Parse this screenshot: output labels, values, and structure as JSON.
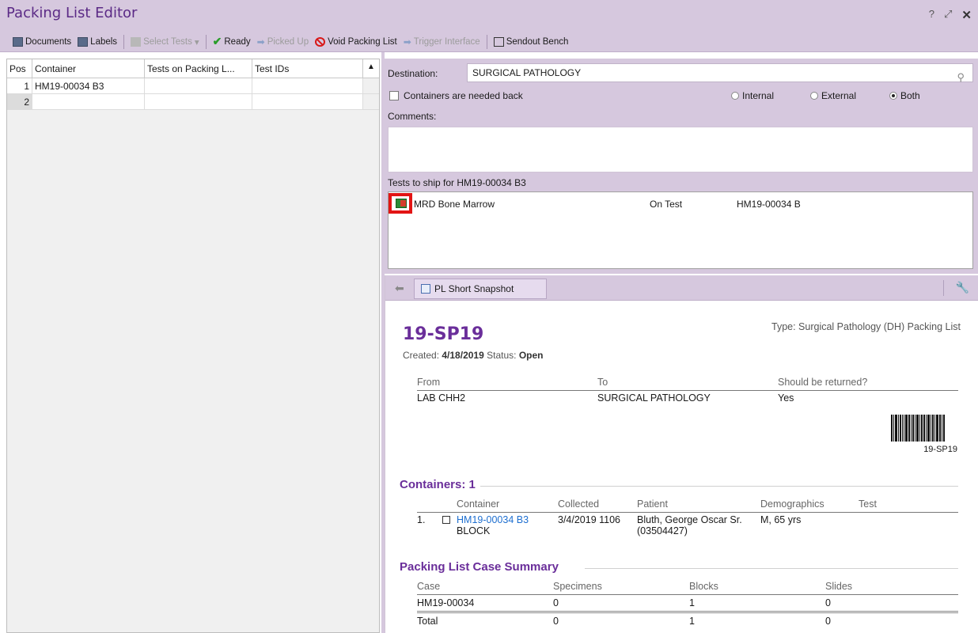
{
  "window": {
    "title": "Packing List Editor"
  },
  "toolbar": {
    "documents": "Documents",
    "labels": "Labels",
    "select_tests": "Select Tests",
    "ready": "Ready",
    "picked_up": "Picked Up",
    "void_packing_list": "Void Packing List",
    "trigger_interface": "Trigger Interface",
    "sendout_bench": "Sendout Bench"
  },
  "grid": {
    "headers": [
      "Pos",
      "Container",
      "Tests on Packing L...",
      "Test IDs"
    ],
    "rows": [
      {
        "pos": "1",
        "container": "HM19-00034 B3",
        "tests": "",
        "ids": ""
      },
      {
        "pos": "2",
        "container": "",
        "tests": "",
        "ids": ""
      }
    ]
  },
  "destination": {
    "label": "Destination:",
    "value": "SURGICAL PATHOLOGY"
  },
  "containers_needed_back": {
    "label": "Containers are needed back",
    "checked": false
  },
  "scope_radios": [
    {
      "label": "Internal",
      "selected": false
    },
    {
      "label": "External",
      "selected": false
    },
    {
      "label": "Both",
      "selected": true
    }
  ],
  "comments": {
    "label": "Comments:",
    "value": ""
  },
  "tests_to_ship": {
    "label": "Tests to ship for HM19-00034 B3",
    "items": [
      {
        "name": "MRD Bone Marrow",
        "status": "On Test",
        "id": "HM19-00034 B"
      }
    ]
  },
  "snapshot": {
    "tab_label": "PL Short Snapshot",
    "packing_list_id": "19-SP19",
    "type_text": "Type: Surgical Pathology (DH) Packing List",
    "created_label": "Created:",
    "created_date": "4/18/2019",
    "status_label": "Status:",
    "status_value": "Open",
    "from_to": {
      "headers": [
        "From",
        "To",
        "Should be returned?"
      ],
      "values": [
        "LAB CHH2",
        "SURGICAL PATHOLOGY",
        "Yes"
      ]
    },
    "barcode_text": "19-SP19",
    "containers_title": "Containers: 1",
    "containers_headers": [
      "Container",
      "Collected",
      "Patient",
      "Demographics",
      "Test"
    ],
    "containers": [
      {
        "num": "1.",
        "container": "HM19-00034 B3",
        "container_type": "BLOCK",
        "collected": "3/4/2019 1106",
        "patient": "Bluth, George Oscar Sr.",
        "patient_id": "(03504427)",
        "demographics": "M, 65 yrs",
        "test": ""
      }
    ],
    "summary_title": "Packing List Case Summary",
    "summary_headers": [
      "Case",
      "Specimens",
      "Blocks",
      "Slides"
    ],
    "summary_rows": [
      [
        "HM19-00034",
        "0",
        "1",
        "0"
      ]
    ],
    "summary_total": [
      "Total",
      "0",
      "1",
      "0"
    ]
  },
  "colors": {
    "accent_purple": "#6a2e9a",
    "panel_lavender": "#d6c8de",
    "highlight_red": "#e21414",
    "link_blue": "#1e6fd0"
  }
}
